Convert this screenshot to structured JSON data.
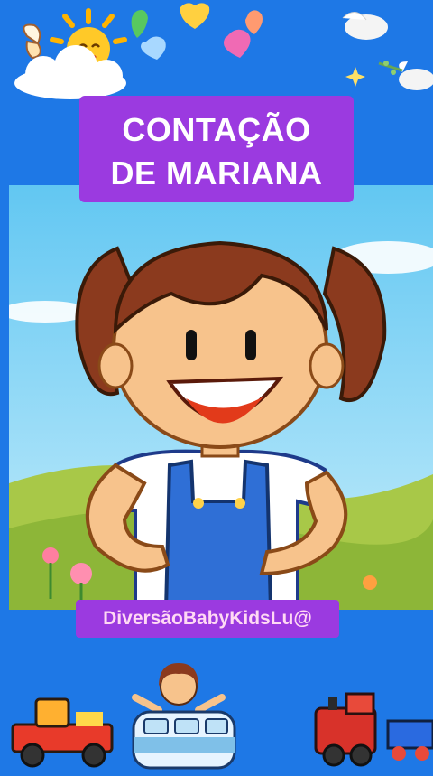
{
  "title": {
    "line1": "CONTAÇÃO",
    "line2": "DE MARIANA"
  },
  "channel": {
    "handle": "DiversãoBabyKidsLu@"
  },
  "colors": {
    "background": "#1e78e6",
    "title_box": "#9b3ae0",
    "channel_tag": "#9b3ae0",
    "sky": "#7fd3f5",
    "grass": "#9cc43c"
  },
  "icons": [
    "sun-icon",
    "cloud-icon",
    "heart-icon",
    "bird-icon",
    "butterfly-icon",
    "sparkle-icon",
    "truck-icon",
    "van-icon",
    "train-icon",
    "girl-sticker-icon"
  ]
}
